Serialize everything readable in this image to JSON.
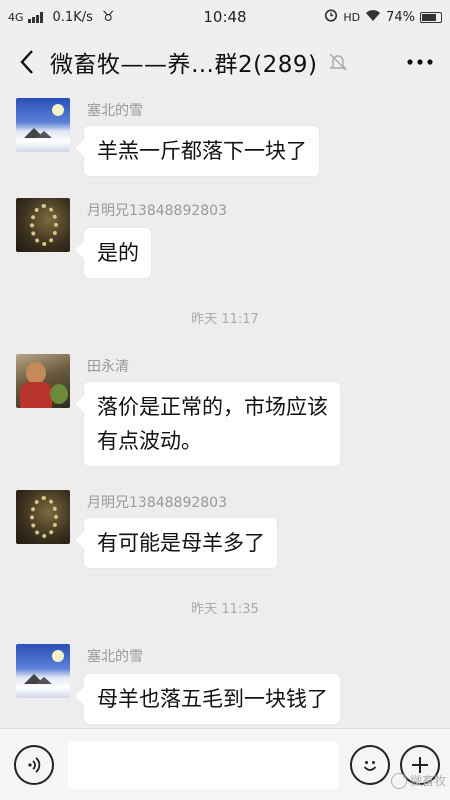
{
  "status_bar": {
    "network": "4G",
    "speed": "0.1K/s",
    "time": "10:48",
    "hd": "HD",
    "battery": "74%"
  },
  "header": {
    "title": "微畜牧——养…群2(289)"
  },
  "chat": {
    "messages": [
      {
        "sender": "塞北的雪",
        "text": "羊羔一斤都落下一块了",
        "avatar": "snow-landscape"
      },
      {
        "sender": "月明兄13848892803",
        "text": "是的",
        "avatar": "prayer-beads"
      },
      {
        "sender": "田永清",
        "text_line1": "落价是正常的，市场应该",
        "text_line2": "有点波动。",
        "avatar": "person-photo"
      },
      {
        "sender": "月明兄13848892803",
        "text": "有可能是母羊多了",
        "avatar": "prayer-beads"
      },
      {
        "sender": "塞北的雪",
        "text": "母羊也落五毛到一块钱了",
        "avatar": "snow-landscape"
      }
    ],
    "timestamps": [
      "昨天 11:17",
      "昨天 11:35"
    ]
  },
  "input_bar": {
    "placeholder": ""
  },
  "watermark": "微畜牧",
  "colors": {
    "background": "#ededed",
    "bubble": "#ffffff",
    "sender": "#999999",
    "timestamp": "#aaaaaa"
  }
}
